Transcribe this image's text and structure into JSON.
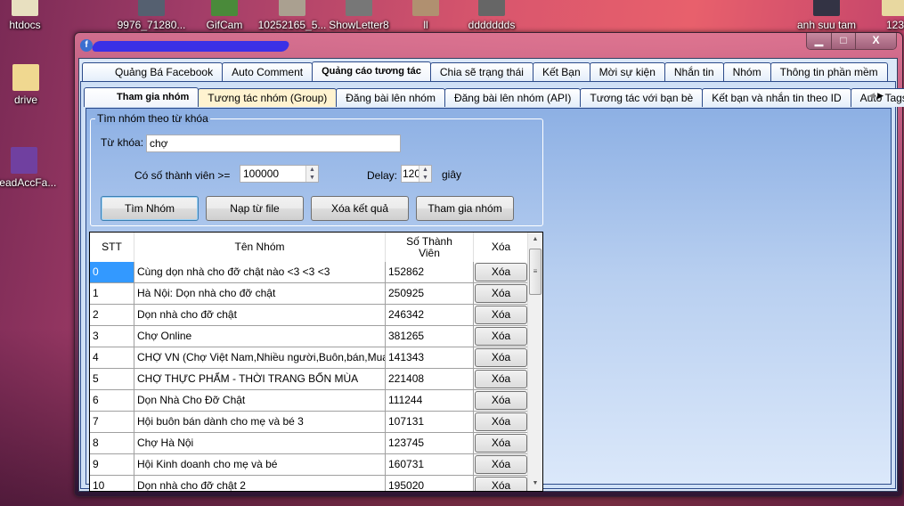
{
  "desktop": {
    "icons": [
      {
        "label": "htdocs"
      },
      {
        "label": "9976_71280..."
      },
      {
        "label": "GifCam"
      },
      {
        "label": "10252165_5..."
      },
      {
        "label": "ShowLetter8"
      },
      {
        "label": "ll"
      },
      {
        "label": "ddddddds"
      },
      {
        "label": "anh suu tam"
      },
      {
        "label": "123"
      },
      {
        "label": "drive"
      },
      {
        "label": "ReadAccFa..."
      }
    ]
  },
  "window": {
    "controls": {
      "minimize": "▁",
      "maximize": "□",
      "close": "X"
    }
  },
  "outer_tabs": [
    "Quảng Bá Facebook",
    "Auto Comment",
    "Quảng cáo tương tác",
    "Chia sẽ trạng thái",
    "Kết Bạn",
    "Mời sự kiện",
    "Nhắn tin",
    "Nhóm",
    "Thông tin phần mềm"
  ],
  "inner_tabs": [
    "Tham gia nhóm",
    "Tương tác nhóm (Group)",
    "Đăng bài lên nhóm",
    "Đăng bài lên nhóm (API)",
    "Tương tác với bạn bè",
    "Kết bạn và nhắn tin theo ID",
    "Auto Tags"
  ],
  "tab_scroll": {
    "left": "◀",
    "right": "▶"
  },
  "search": {
    "group_title": "Tìm nhóm theo từ khóa",
    "keyword_label": "Từ khóa:",
    "keyword_value": "chợ",
    "members_label": "Có số thành viên >=",
    "members_value": "100000",
    "delay_label": "Delay:",
    "delay_value": "120",
    "delay_unit": "giây",
    "buttons": {
      "find": "Tìm Nhóm",
      "load": "Nạp từ file",
      "clear": "Xóa kết quả",
      "join": "Tham gia nhóm"
    }
  },
  "grid": {
    "headers": {
      "stt": "STT",
      "name": "Tên Nhóm",
      "members": "Số Thành Viên",
      "delete": "Xóa"
    },
    "rows": [
      {
        "stt": "0",
        "name": "Cùng dọn nhà cho đỡ chật nào <3 <3 <3",
        "members": "152862",
        "action": "Xóa"
      },
      {
        "stt": "1",
        "name": "Hà Nội: Dọn nhà cho đỡ chật",
        "members": "250925",
        "action": "Xóa"
      },
      {
        "stt": "2",
        "name": "Dọn nhà cho đỡ chật",
        "members": "246342",
        "action": "Xóa"
      },
      {
        "stt": "3",
        "name": "Chợ Online",
        "members": "381265",
        "action": "Xóa"
      },
      {
        "stt": "4",
        "name": "CHỢ VN (Chợ Việt Nam,Nhiều người,Buôn,bán,Mua hà...",
        "members": "141343",
        "action": "Xóa"
      },
      {
        "stt": "5",
        "name": "CHỢ THỰC PHẨM - THỜI TRANG BỐN MÙA",
        "members": "221408",
        "action": "Xóa"
      },
      {
        "stt": "6",
        "name": "Dọn Nhà Cho Đỡ Chật",
        "members": "111244",
        "action": "Xóa"
      },
      {
        "stt": "7",
        "name": "Hội buôn bán dành cho mẹ và bé 3",
        "members": "107131",
        "action": "Xóa"
      },
      {
        "stt": "8",
        "name": "Chợ Hà Nội",
        "members": "123745",
        "action": "Xóa"
      },
      {
        "stt": "9",
        "name": "Hội Kinh doanh cho mẹ và bé",
        "members": "160731",
        "action": "Xóa"
      },
      {
        "stt": "10",
        "name": "Dọn nhà cho đỡ chật 2",
        "members": "195020",
        "action": "Xóa"
      }
    ]
  },
  "colors": {
    "selected_cell": "#3399ff",
    "panel": "#8db0e4"
  }
}
